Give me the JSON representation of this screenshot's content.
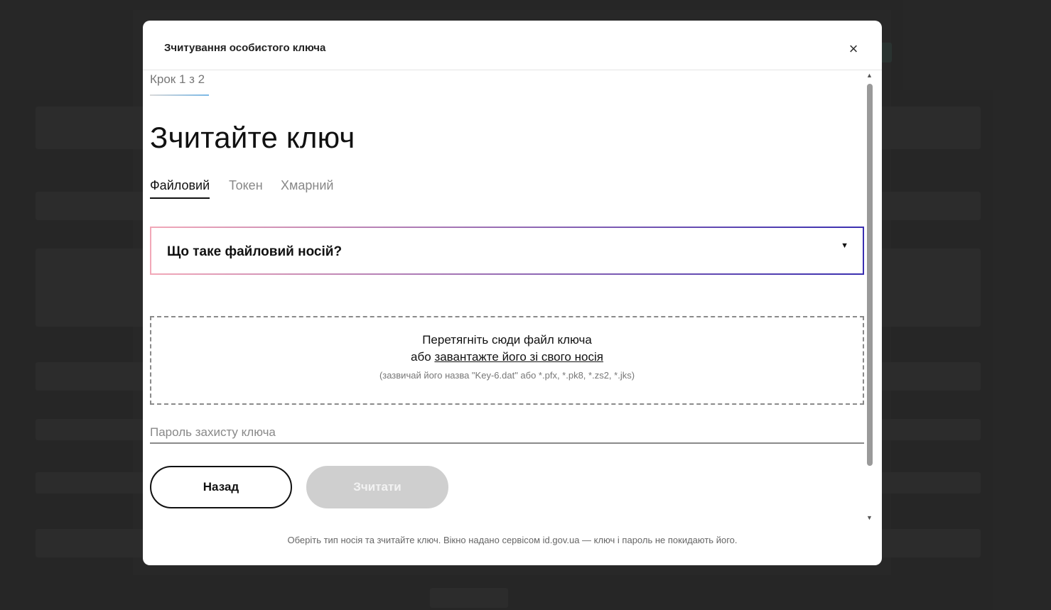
{
  "modal": {
    "title": "Зчитування особистого ключа",
    "close_icon": "×",
    "step_label": "Крок 1 з 2",
    "heading": "Зчитайте ключ",
    "tabs": [
      {
        "label": "Файловий",
        "active": true
      },
      {
        "label": "Токен",
        "active": false
      },
      {
        "label": "Хмарний",
        "active": false
      }
    ],
    "accordion": {
      "title": "Що таке файловий носій?",
      "arrow_icon": "▼"
    },
    "dropzone": {
      "line1": "Перетягніть сюди файл ключа",
      "line2_prefix": "або",
      "line2_link": "завантажте його зі свого носія",
      "hint": "(зазвичай його назва \"Key-6.dat\" або *.pfx, *.pk8, *.zs2, *.jks)"
    },
    "password": {
      "placeholder": "Пароль захисту ключа",
      "value": ""
    },
    "buttons": {
      "back": "Назад",
      "read": "Зчитати"
    },
    "footer_note": "Оберіть тип носія та зчитайте ключ. Вікно надано сервісом id.gov.ua — ключ і пароль не покидають його."
  },
  "colors": {
    "accent_border": "#3a2fb0",
    "disabled_button": "#cfcfcf",
    "overlay": "#262626"
  }
}
